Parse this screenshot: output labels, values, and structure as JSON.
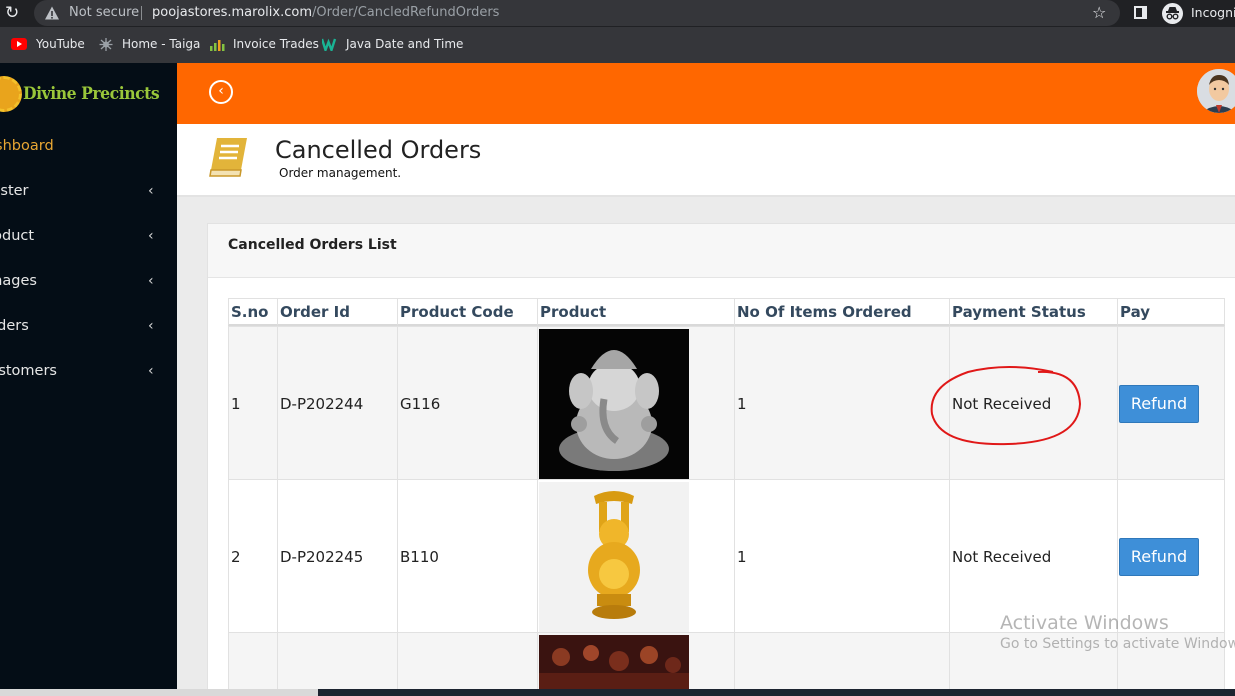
{
  "browser": {
    "security_label": "Not secure",
    "url_host": "poojastores.marolix.com",
    "url_path": "/Order/CancledRefundOrders",
    "incognito_label": "Incognito",
    "bookmarks": [
      {
        "label": "YouTube",
        "icon": "youtube-icon",
        "color": "#ff0000"
      },
      {
        "label": "Home - Taiga",
        "icon": "taiga-icon",
        "color": "#9aa0a6"
      },
      {
        "label": "Invoice Trades",
        "icon": "chart-icon",
        "color": "#83c341"
      },
      {
        "label": "Java Date and Time",
        "icon": "w-icon",
        "color": "#1ab394"
      }
    ]
  },
  "sidebar": {
    "brand": "Divine Precincts",
    "items": [
      {
        "label": "Dashboard",
        "active": true
      },
      {
        "label": "Master"
      },
      {
        "label": "Product"
      },
      {
        "label": "Images"
      },
      {
        "label": "Orders"
      },
      {
        "label": "Customers"
      }
    ]
  },
  "header": {
    "accent": "#ff6700",
    "title": "Cancelled Orders",
    "subtitle": "Order management."
  },
  "card": {
    "title": "Cancelled Orders List"
  },
  "table": {
    "columns": [
      "S.no",
      "Order Id",
      "Product Code",
      "Product",
      "No Of Items Ordered",
      "Payment Status",
      "Pay"
    ],
    "rows": [
      {
        "sno": "1",
        "order_id": "D-P202244",
        "product_code": "G116",
        "product_image": "silver-ganesha-idol",
        "items": "1",
        "payment_status": "Not Received",
        "action": "Refund"
      },
      {
        "sno": "2",
        "order_id": "D-P202245",
        "product_code": "B110",
        "product_image": "golden-laughing-buddha",
        "items": "1",
        "payment_status": "Not Received",
        "action": "Refund"
      },
      {
        "sno": "",
        "order_id": "",
        "product_code": "",
        "product_image": "festival-crowd-image",
        "items": "",
        "payment_status": "",
        "action": ""
      }
    ]
  },
  "watermark": {
    "line1": "Activate Windows",
    "line2": "Go to Settings to activate Windows."
  }
}
